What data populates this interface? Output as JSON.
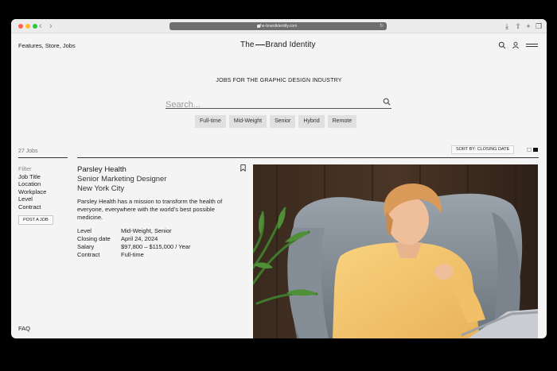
{
  "browser": {
    "url": "the-brandidentity.com",
    "back_icon": "chevron-left-icon",
    "forward_icon": "chevron-right-icon"
  },
  "header": {
    "nav_text": "Features, Store, Jobs",
    "logo_left": "The",
    "logo_right": "Brand Identity"
  },
  "hero": {
    "tagline": "JOBS FOR THE GRAPHIC DESIGN INDUSTRY",
    "search_placeholder": "Search..."
  },
  "chips": [
    "Full-time",
    "Mid-Weight",
    "Senior",
    "Hybrid",
    "Remote"
  ],
  "listing": {
    "count_label": "27 Jobs",
    "sort_label": "SORT BY: CLOSING DATE"
  },
  "sidebar": {
    "filter_label": "Filter",
    "filters": [
      "Job Title",
      "Location",
      "Workplace",
      "Level",
      "Contract"
    ],
    "post_button": "POST A JOB",
    "faq": "FAQ"
  },
  "job": {
    "company": "Parsley Health",
    "title": "Senior Marketing Designer",
    "location": "New York City",
    "description": "Parsley Health has a mission to transform the health of everyone, everywhere with the world’s best possible medicine.",
    "details": [
      {
        "key": "Level",
        "value": "Mid-Weight, Senior"
      },
      {
        "key": "Closing date",
        "value": "April 24, 2024"
      },
      {
        "key": "Salary",
        "value": "$97,800 – $115,000 / Year"
      },
      {
        "key": "Contract",
        "value": "Full-time"
      }
    ]
  },
  "colors": {
    "page_bg": "#f4f4f4",
    "chip_bg": "#e0e0e0",
    "text": "#1a1a1a",
    "shirt": "#f7c76a"
  }
}
